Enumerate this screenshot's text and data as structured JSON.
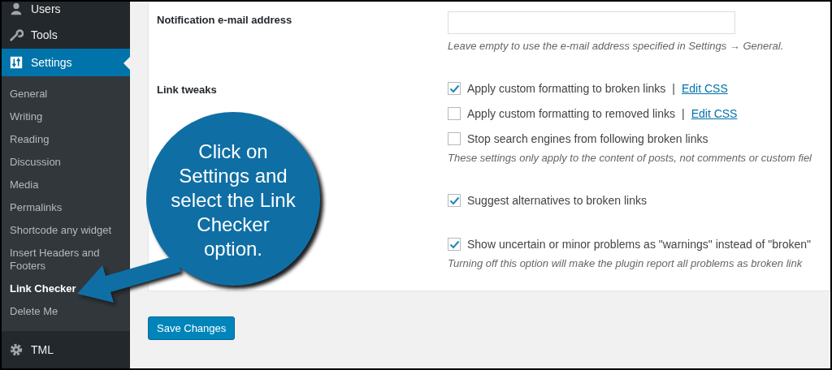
{
  "sidebar": {
    "items": [
      {
        "kind": "menu",
        "label": "Users",
        "selected": false
      },
      {
        "kind": "menu",
        "label": "Tools",
        "selected": false
      },
      {
        "kind": "menu",
        "label": "Settings",
        "selected": true
      },
      {
        "kind": "submenu",
        "label": "General",
        "selected": false
      },
      {
        "kind": "submenu",
        "label": "Writing",
        "selected": false
      },
      {
        "kind": "submenu",
        "label": "Reading",
        "selected": false
      },
      {
        "kind": "submenu",
        "label": "Discussion",
        "selected": false
      },
      {
        "kind": "submenu",
        "label": "Media",
        "selected": false
      },
      {
        "kind": "submenu",
        "label": "Permalinks",
        "selected": false
      },
      {
        "kind": "submenu",
        "label": "Shortcode any widget",
        "selected": false
      },
      {
        "kind": "submenu",
        "label": "Insert Headers and Footers",
        "selected": false
      },
      {
        "kind": "submenu",
        "label": "Link Checker",
        "selected": true
      },
      {
        "kind": "submenu",
        "label": "Delete Me",
        "selected": false
      },
      {
        "kind": "menu",
        "label": "TML",
        "selected": false
      }
    ]
  },
  "form": {
    "rows": [
      {
        "label": "Notification e-mail address",
        "fields": [
          {
            "kind": "input"
          }
        ],
        "description": "Leave empty to use the e-mail address specified in Settings → General."
      },
      {
        "label": "Link tweaks",
        "fields": [
          {
            "kind": "checkbox",
            "label": "Apply custom formatting to broken links",
            "checked": true,
            "separator": "|",
            "link": "Edit CSS"
          },
          {
            "kind": "checkbox",
            "label": "Apply custom formatting to removed links",
            "checked": false,
            "separator": "|",
            "link": "Edit CSS"
          },
          {
            "kind": "checkbox",
            "label": "Stop search engines from following broken links",
            "checked": false
          }
        ],
        "description": "These settings only apply to the content of posts, not comments or custom fiel"
      },
      {
        "fields": [
          {
            "kind": "checkbox",
            "label": "Suggest alternatives to broken links",
            "checked": true
          }
        ]
      },
      {
        "fields": [
          {
            "kind": "checkbox",
            "label": "Show uncertain or minor problems as \"warnings\" instead of \"broken\"",
            "checked": true
          }
        ],
        "description": "Turning off this option will make the plugin report all problems as broken link"
      }
    ]
  },
  "save_button": "Save Changes",
  "callout": {
    "text": "Click on Settings and select the Link Checker option."
  }
}
